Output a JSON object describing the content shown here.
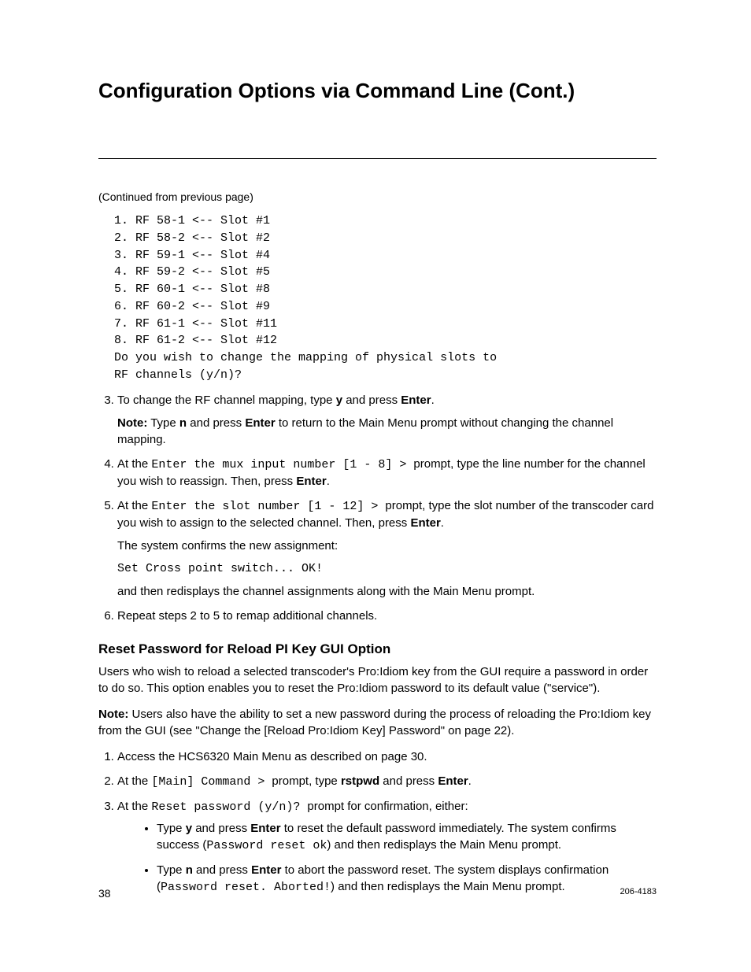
{
  "title": "Configuration Options via Command Line (Cont.)",
  "continued": "(Continued from previous page)",
  "mono_block": "1. RF 58-1 <-- Slot #1\n2. RF 58-2 <-- Slot #2\n3. RF 59-1 <-- Slot #4\n4. RF 59-2 <-- Slot #5\n5. RF 60-1 <-- Slot #8\n6. RF 60-2 <-- Slot #9\n7. RF 61-1 <-- Slot #11\n8. RF 61-2 <-- Slot #12\nDo you wish to change the mapping of physical slots to\nRF channels (y/n)?",
  "step3": {
    "pre": "To change the RF channel mapping, type ",
    "y": "y",
    "mid": " and press ",
    "enter": "Enter",
    "end": ".",
    "note_lbl": "Note:",
    "note_txt1": " Type ",
    "n": "n",
    "note_txt2": " and press ",
    "note_txt3": " to return to the Main Menu prompt without changing the channel mapping."
  },
  "step4": {
    "pre": "At the ",
    "mono": "Enter the mux input number [1 - 8] > ",
    "mid": "prompt, type the line number for the channel you wish to reassign. Then, press ",
    "enter": "Enter",
    "end": "."
  },
  "step5": {
    "pre": "At the ",
    "mono": "Enter the slot number [1 - 12] > ",
    "mid": "prompt, type the slot number of the transcoder card you wish to assign to the selected channel. Then, press ",
    "enter": "Enter",
    "end": ".",
    "confirm_txt": "The system confirms the new assignment:",
    "confirm_mono": "Set Cross point switch... OK!",
    "after": "and then redisplays the channel assignments along with the Main Menu prompt."
  },
  "step6": "Repeat steps 2 to 5 to remap additional channels.",
  "h2": "Reset Password for Reload PI Key GUI Option",
  "para1": "Users who wish to reload a selected transcoder's Pro:Idiom key from the GUI require a password in order to do so. This option enables you to reset the Pro:Idiom password to its default value (\"service\").",
  "para2": {
    "lbl": "Note:",
    "txt": " Users also have the ability to set a new password during the process of reloading the Pro:Idiom key from the GUI (see \"Change the [Reload Pro:Idiom Key] Password\" on page 22)."
  },
  "rsteps": {
    "s1": "Access the HCS6320 Main Menu as described on page 30.",
    "s2": {
      "pre": "At the ",
      "mono": "[Main] Command > ",
      "mid": "prompt, type ",
      "cmd": "rstpwd",
      "mid2": " and press ",
      "enter": "Enter",
      "end": "."
    },
    "s3": {
      "pre": "At the ",
      "mono": "Reset password (y/n)? ",
      "mid": "prompt for confirmation, either:"
    }
  },
  "bullets": {
    "b1": {
      "pre": "Type ",
      "y": "y",
      "mid": " and press ",
      "enter": "Enter",
      "mid2": " to reset the default password immediately. The system confirms success (",
      "mono": "Password reset ok",
      "end": ") and then redisplays the Main Menu prompt."
    },
    "b2": {
      "pre": "Type ",
      "n": "n",
      "mid": " and press ",
      "enter": "Enter",
      "mid2": " to abort the password reset. The system displays confirmation (",
      "mono": "Password reset. Aborted!",
      "end": ") and then redisplays the Main Menu prompt."
    }
  },
  "footer": {
    "page": "38",
    "docid": "206-4183"
  }
}
